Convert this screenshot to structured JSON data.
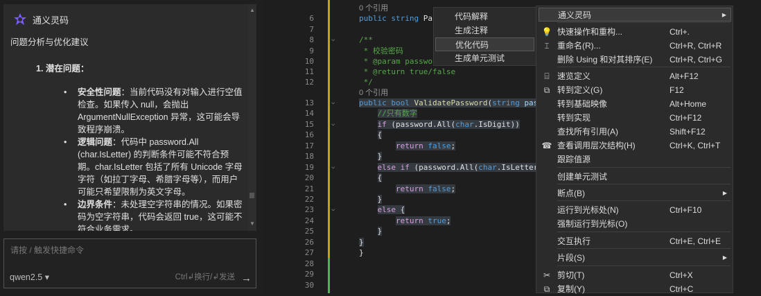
{
  "chat": {
    "title": "通义灵码",
    "heading": "问题分析与优化建议",
    "section": "1.  潜在问题：",
    "bullets": [
      {
        "label": "安全性问题",
        "text": "：当前代码没有对输入进行空值检查。如果传入 null，会抛出 ArgumentNullException 异常，这可能会导致程序崩溃。"
      },
      {
        "label": "逻辑问题",
        "text": "：代码中 password.All (char.IsLetter) 的判断条件可能不符合预期。char.IsLetter 包括了所有 Unicode 字母字符（如拉丁字母、希腊字母等），而用户可能只希望限制为英文字母。"
      },
      {
        "label": "边界条件",
        "text": "：未处理空字符串的情况。如果密码为空字符串，代码会返回 true，这可能不符合业务需求。"
      }
    ],
    "input_placeholder": "请按 / 触发快捷命令",
    "model": "qwen2.5 ▾",
    "hint": "Ctrl↲换行/↲发送",
    "send_icon": "→"
  },
  "editor": {
    "lines": [
      {
        "n": "",
        "tokens": [
          [
            "0 个引用",
            "lens"
          ]
        ]
      },
      {
        "n": "6",
        "tokens": [
          [
            "public ",
            "kw"
          ],
          [
            "string ",
            "kw"
          ],
          [
            "Pass",
            ""
          ]
        ]
      },
      {
        "n": "7",
        "tokens": []
      },
      {
        "n": "8",
        "tokens": [
          [
            "/**",
            "cm"
          ]
        ]
      },
      {
        "n": "9",
        "tokens": [
          [
            " * 校验密码",
            "cm"
          ]
        ]
      },
      {
        "n": "10",
        "tokens": [
          [
            " * @param password",
            "cm"
          ]
        ]
      },
      {
        "n": "11",
        "tokens": [
          [
            " * @return true/false",
            "cm"
          ]
        ]
      },
      {
        "n": "12",
        "tokens": [
          [
            " */",
            "cm"
          ]
        ]
      },
      {
        "n": "",
        "tokens": [
          [
            "0 个引用",
            "lens"
          ]
        ]
      },
      {
        "n": "13",
        "tokens": [
          [
            "public ",
            "kw sel"
          ],
          [
            "bool ",
            "kw sel"
          ],
          [
            "ValidatePassword",
            "fn sel"
          ],
          [
            "(",
            "sel"
          ],
          [
            "string ",
            "kw sel"
          ],
          [
            "passwo",
            "pa sel"
          ]
        ]
      },
      {
        "n": "14",
        "tokens": [
          [
            "    ",
            ""
          ],
          [
            "//只有数字",
            "cm sel"
          ]
        ]
      },
      {
        "n": "15",
        "tokens": [
          [
            "    ",
            ""
          ],
          [
            "if ",
            "ctl sel"
          ],
          [
            "(password.All(",
            "sel"
          ],
          [
            "char",
            "ty sel"
          ],
          [
            ".IsDigit))",
            "sel"
          ]
        ]
      },
      {
        "n": "16",
        "tokens": [
          [
            "    ",
            ""
          ],
          [
            "{",
            "sel"
          ]
        ]
      },
      {
        "n": "17",
        "tokens": [
          [
            "        ",
            ""
          ],
          [
            "return ",
            "ctl sel"
          ],
          [
            "false",
            "kw sel"
          ],
          [
            ";",
            "sel"
          ]
        ]
      },
      {
        "n": "18",
        "tokens": [
          [
            "    ",
            ""
          ],
          [
            "}",
            "sel"
          ]
        ]
      },
      {
        "n": "19",
        "tokens": [
          [
            "    ",
            ""
          ],
          [
            "else ",
            "ctl sel"
          ],
          [
            "if ",
            "ctl sel"
          ],
          [
            "(password.All(",
            "sel"
          ],
          [
            "char",
            "ty sel"
          ],
          [
            ".IsLetter))",
            "sel"
          ]
        ]
      },
      {
        "n": "20",
        "tokens": [
          [
            "    ",
            ""
          ],
          [
            "{",
            "sel"
          ]
        ]
      },
      {
        "n": "21",
        "tokens": [
          [
            "        ",
            ""
          ],
          [
            "return ",
            "ctl sel"
          ],
          [
            "false",
            "kw sel"
          ],
          [
            ";",
            "sel"
          ]
        ]
      },
      {
        "n": "22",
        "tokens": [
          [
            "    ",
            ""
          ],
          [
            "}",
            "sel"
          ]
        ]
      },
      {
        "n": "23",
        "tokens": [
          [
            "    ",
            ""
          ],
          [
            "else ",
            "ctl sel"
          ],
          [
            "{",
            "sel"
          ]
        ]
      },
      {
        "n": "24",
        "tokens": [
          [
            "        ",
            ""
          ],
          [
            "return ",
            "ctl sel"
          ],
          [
            "true",
            "kw sel"
          ],
          [
            ";",
            "sel"
          ]
        ]
      },
      {
        "n": "25",
        "tokens": [
          [
            "    ",
            ""
          ],
          [
            "}",
            "sel"
          ]
        ]
      },
      {
        "n": "26",
        "tokens": [
          [
            "}",
            "sel"
          ]
        ]
      },
      {
        "n": "27",
        "tokens": [
          [
            "}",
            ""
          ]
        ]
      },
      {
        "n": "28",
        "tokens": []
      },
      {
        "n": "29",
        "tokens": []
      },
      {
        "n": "30",
        "tokens": []
      }
    ]
  },
  "submenu": {
    "items": [
      "代码解释",
      "生成注释",
      "优化代码",
      "生成单元测试"
    ],
    "selected": 2
  },
  "menu": {
    "items": [
      {
        "label": "通义灵码",
        "shortcut": "",
        "arrow": true,
        "icon": ""
      },
      {
        "label": "快速操作和重构...",
        "shortcut": "Ctrl+.",
        "icon": "💡"
      },
      {
        "label": "重命名(R)...",
        "shortcut": "Ctrl+R, Ctrl+R",
        "icon": "⌶"
      },
      {
        "label": "删除 Using 和对其排序(E)",
        "shortcut": "Ctrl+R, Ctrl+G",
        "icon": ""
      },
      {
        "label": "速览定义",
        "shortcut": "Alt+F12",
        "icon": "⌸"
      },
      {
        "label": "转到定义(G)",
        "shortcut": "F12",
        "icon": "⧉"
      },
      {
        "label": "转到基础映像",
        "shortcut": "Alt+Home",
        "icon": ""
      },
      {
        "label": "转到实现",
        "shortcut": "Ctrl+F12",
        "icon": ""
      },
      {
        "label": "查找所有引用(A)",
        "shortcut": "Shift+F12",
        "icon": ""
      },
      {
        "label": "查看调用层次结构(H)",
        "shortcut": "Ctrl+K, Ctrl+T",
        "icon": "☎"
      },
      {
        "label": "跟踪值源",
        "shortcut": "",
        "icon": ""
      },
      {
        "label": "创建单元测试",
        "shortcut": "",
        "icon": ""
      },
      {
        "label": "断点(B)",
        "shortcut": "",
        "arrow": true,
        "icon": ""
      },
      {
        "label": "运行到光标处(N)",
        "shortcut": "Ctrl+F10",
        "icon": ""
      },
      {
        "label": "强制运行到光标(O)",
        "shortcut": "",
        "icon": ""
      },
      {
        "label": "交互执行",
        "shortcut": "Ctrl+E, Ctrl+E",
        "icon": ""
      },
      {
        "label": "片段(S)",
        "shortcut": "",
        "arrow": true,
        "icon": ""
      },
      {
        "label": "剪切(T)",
        "shortcut": "Ctrl+X",
        "icon": "✂"
      },
      {
        "label": "复制(Y)",
        "shortcut": "Ctrl+C",
        "icon": "⧉"
      }
    ]
  }
}
